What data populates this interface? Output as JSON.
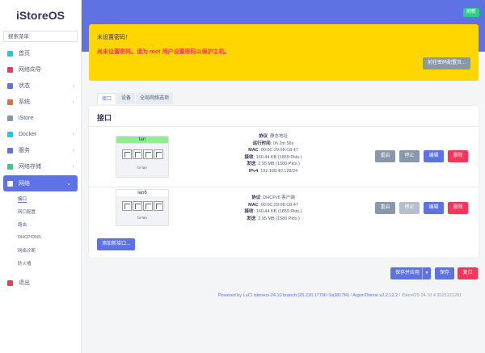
{
  "brand": "iStoreOS",
  "search_placeholder": "搜索菜单",
  "nav": [
    {
      "label": "首页",
      "color": "#11cdef",
      "chev": false
    },
    {
      "label": "网络向导",
      "color": "#f5365c",
      "chev": false
    },
    {
      "label": "状态",
      "color": "#5e72e4",
      "chev": true
    },
    {
      "label": "系统",
      "color": "#fb6340",
      "chev": true
    },
    {
      "label": "iStore",
      "color": "#8898aa",
      "chev": false
    },
    {
      "label": "Docker",
      "color": "#11cdef",
      "chev": true
    },
    {
      "label": "服务",
      "color": "#5e72e4",
      "chev": true
    },
    {
      "label": "网络存储",
      "color": "#2dce89",
      "chev": true
    },
    {
      "label": "网络",
      "color": "#ffffff",
      "chev": true,
      "active": true
    }
  ],
  "subnav": [
    "接口",
    "网口配置",
    "路由",
    "DHCP/DNS",
    "网络诊断",
    "防火墙"
  ],
  "logout": "退出",
  "refresh_badge": "刷新",
  "alert": {
    "title": "未设置密码！",
    "message": "尚未设置密码。请为 root 用户设置密码以保护主机。",
    "button": "前往密码配置页..."
  },
  "tabs": [
    "接口",
    "设备",
    "全局网络选项"
  ],
  "card_title": "接口",
  "interfaces": [
    {
      "name": "lan",
      "head_color": "#90ee90",
      "device": "br-lan",
      "info": [
        {
          "k": "协议",
          "v": "静态地址"
        },
        {
          "k": "运行时间",
          "v": "0h 2m 58s"
        },
        {
          "k": "MAC",
          "v": "00:0C:29:68:C8:47"
        },
        {
          "k": "接收",
          "v": "160.44 KB (1859 Pkts.)"
        },
        {
          "k": "发送",
          "v": "2.95 MB (1580 Pkts.)"
        },
        {
          "k": "IPv4",
          "v": "192.168.40.128/24"
        }
      ],
      "buttons": {
        "restart": "重启",
        "stop": "停止",
        "edit": "编辑",
        "delete": "删除"
      }
    },
    {
      "name": "lan6",
      "head_color": "#ffffff",
      "device": "br-lan",
      "info": [
        {
          "k": "协议",
          "v": "DHCPv6 客户端"
        },
        {
          "k": "MAC",
          "v": "00:0C:29:68:C8:47"
        },
        {
          "k": "接收",
          "v": "160.44 KB (1859 Pkts.)"
        },
        {
          "k": "发送",
          "v": "2.95 MB (1580 Pkts.)"
        }
      ],
      "buttons": {
        "restart": "重启",
        "stop": "停止",
        "edit": "编辑",
        "delete": "删除"
      }
    }
  ],
  "add_button": "添加新接口...",
  "footer_actions": {
    "save_apply": "保存并应用",
    "save": "保存",
    "reset": "复位"
  },
  "footer": {
    "link": "Powered by LuCI istoreos-24.10 branch (25.220.17796~9a3817f4)",
    "sep": " / ",
    "theme": "ArgonTheme v2.2.12.2",
    "version": " / iStoreOS 24.10.4 2025121201"
  }
}
